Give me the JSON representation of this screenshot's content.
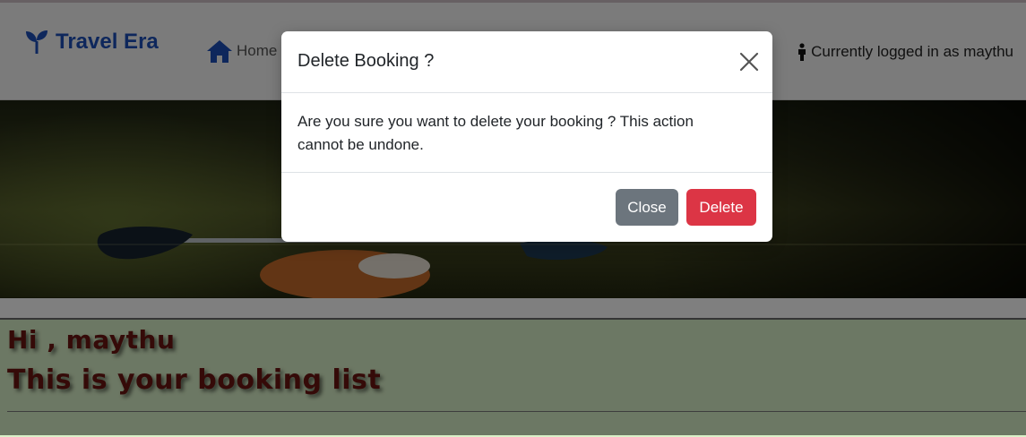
{
  "navbar": {
    "brand": "Travel Era",
    "home_label": "Home",
    "login_status": "Currently logged in as maythu"
  },
  "content": {
    "greeting": "Hi , maythu",
    "list_title": "This is your booking list"
  },
  "modal": {
    "title": "Delete Booking ?",
    "message": "Are you sure you want to delete your booking ? This action cannot be undone.",
    "close_label": "Close",
    "delete_label": "Delete"
  },
  "colors": {
    "brand": "#1d4fb8",
    "danger": "#dc3545",
    "secondary": "#6c757d",
    "heading": "#6b1410",
    "content_bg": "#d9f0c8"
  },
  "icons": {
    "brand": "sprout-icon",
    "home": "home-icon",
    "user": "person-icon",
    "close": "close-icon"
  }
}
